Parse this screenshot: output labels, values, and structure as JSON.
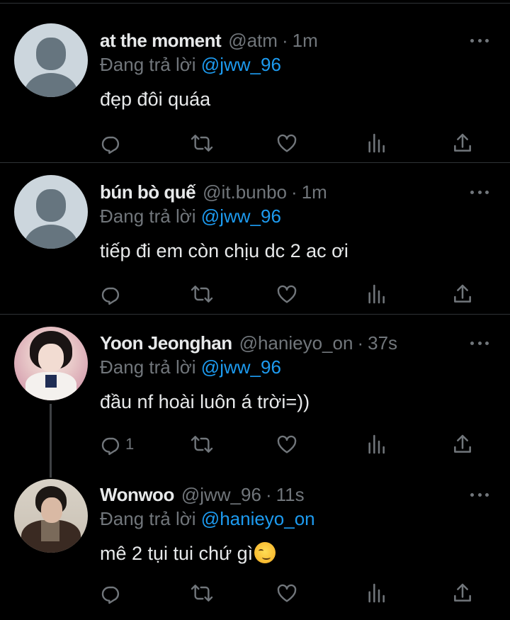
{
  "tweets": [
    {
      "name": "at the moment",
      "handle": "@atm",
      "separator": "·",
      "time": "1m",
      "replying_prefix": "Đang trả lời",
      "replying_to": "@jww_96",
      "text": "đẹp đôi quáa",
      "reply_count": "",
      "avatar": "default-avatar"
    },
    {
      "name": "bún bò quế",
      "handle": "@it.bunbo",
      "separator": "·",
      "time": "1m",
      "replying_prefix": "Đang trả lời",
      "replying_to": "@jww_96",
      "text": "tiếp đi em còn chịu dc 2 ac ơi",
      "reply_count": "",
      "avatar": "default-avatar"
    },
    {
      "name": "Yoon Jeonghan",
      "handle": "@hanieyo_on",
      "separator": "·",
      "time": "37s",
      "replying_prefix": "Đang trả lời",
      "replying_to": "@jww_96",
      "text": "đầu nf hoài luôn á trời=))",
      "reply_count": "1",
      "avatar": "photo-avatar"
    },
    {
      "name": "Wonwoo",
      "handle": "@jww_96",
      "separator": "·",
      "time": "11s",
      "replying_prefix": "Đang trả lời",
      "replying_to": "@hanieyo_on",
      "text": "mê 2 tụi tui chứ gì",
      "emoji": "smirking-face-emoji",
      "reply_count": "",
      "avatar": "photo-avatar"
    }
  ],
  "icons": {
    "reply": "reply-icon",
    "retweet": "retweet-icon",
    "like": "heart-icon",
    "views": "views-icon",
    "share": "share-icon",
    "more": "more-icon"
  },
  "colors": {
    "background": "#000000",
    "text": "#e7e9ea",
    "muted": "#71767b",
    "mention": "#1d9bf0",
    "divider": "#2f3336"
  }
}
